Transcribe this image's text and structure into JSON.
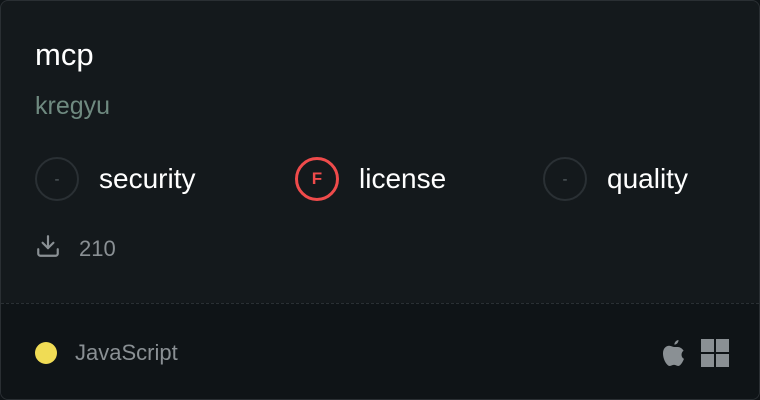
{
  "package": {
    "name": "mcp",
    "author": "kregyu"
  },
  "metrics": [
    {
      "badge": "-",
      "label": "security",
      "status": "neutral"
    },
    {
      "badge": "F",
      "label": "license",
      "status": "fail"
    },
    {
      "badge": "-",
      "label": "quality",
      "status": "neutral"
    }
  ],
  "downloads": {
    "icon": "download-icon",
    "count": "210"
  },
  "footer": {
    "language": "JavaScript",
    "language_color": "#f0dc55",
    "platforms": [
      "apple-icon",
      "windows-icon"
    ]
  },
  "colors": {
    "fail": "#ef4b4b",
    "author": "#6f8a80"
  }
}
